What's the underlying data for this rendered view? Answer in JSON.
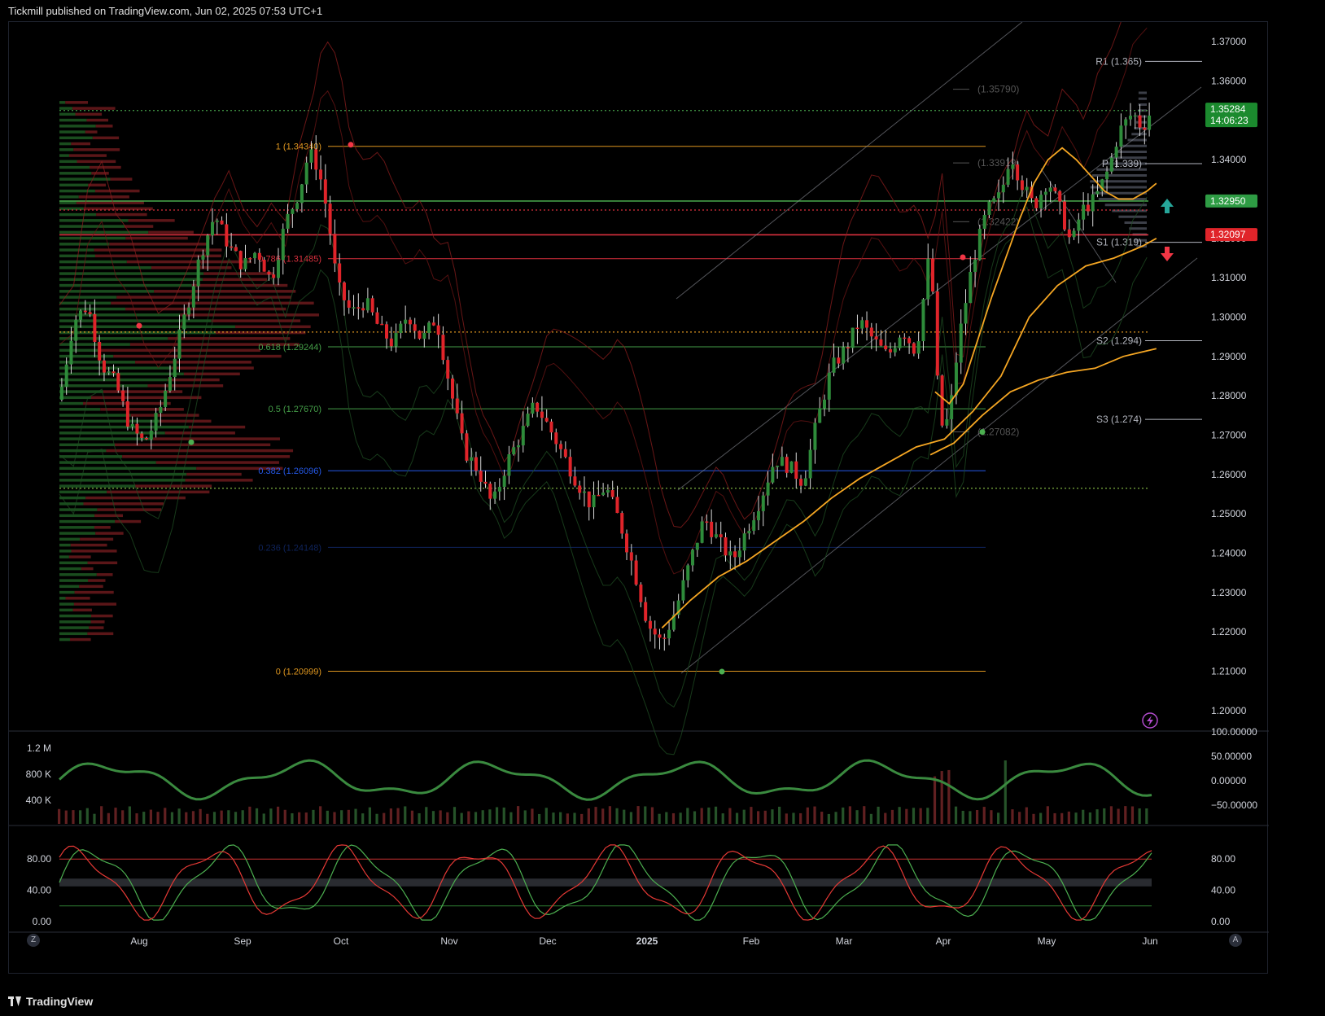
{
  "header": {
    "text": "Tickmill published on TradingView.com, Jun 02, 2025 07:53 UTC+1"
  },
  "footer": {
    "brand": "TradingView"
  },
  "buttons": {
    "left": "Z",
    "right": "A"
  },
  "colors": {
    "up": "#2e8b3a",
    "down": "#e0242a",
    "orange": "#f5a623",
    "green_line": "#4caf50",
    "red_line": "#f23645",
    "blue": "#2962ff"
  },
  "chart_data": {
    "type": "candlestick",
    "ylim": [
      1.195,
      1.375
    ],
    "price_ticks": [
      "1.37000",
      "1.36000",
      "1.35000",
      "1.34000",
      "1.33000",
      "1.32000",
      "1.31000",
      "1.30000",
      "1.29000",
      "1.28000",
      "1.27000",
      "1.26000",
      "1.25000",
      "1.24000",
      "1.23000",
      "1.22000",
      "1.21000",
      "1.20000"
    ],
    "x_ticks": [
      "Aug",
      "Sep",
      "Oct",
      "Nov",
      "Dec",
      "2025",
      "Feb",
      "Mar",
      "Apr",
      "May",
      "Jun"
    ],
    "close_path": [
      [
        0,
        1.279
      ],
      [
        6,
        1.299
      ],
      [
        12,
        1.303
      ],
      [
        18,
        1.288
      ],
      [
        24,
        1.283
      ],
      [
        30,
        1.272
      ],
      [
        36,
        1.268
      ],
      [
        42,
        1.275
      ],
      [
        48,
        1.288
      ],
      [
        54,
        1.302
      ],
      [
        60,
        1.316
      ],
      [
        66,
        1.326
      ],
      [
        72,
        1.318
      ],
      [
        78,
        1.313
      ],
      [
        84,
        1.317
      ],
      [
        90,
        1.309
      ],
      [
        96,
        1.324
      ],
      [
        102,
        1.332
      ],
      [
        106,
        1.342
      ],
      [
        110,
        1.338
      ],
      [
        114,
        1.326
      ],
      [
        118,
        1.308
      ],
      [
        124,
        1.301
      ],
      [
        130,
        1.304
      ],
      [
        136,
        1.297
      ],
      [
        142,
        1.293
      ],
      [
        148,
        1.301
      ],
      [
        154,
        1.294
      ],
      [
        160,
        1.3
      ],
      [
        166,
        1.282
      ],
      [
        172,
        1.266
      ],
      [
        178,
        1.261
      ],
      [
        184,
        1.252
      ],
      [
        190,
        1.263
      ],
      [
        196,
        1.27
      ],
      [
        202,
        1.278
      ],
      [
        208,
        1.272
      ],
      [
        214,
        1.265
      ],
      [
        220,
        1.258
      ],
      [
        226,
        1.252
      ],
      [
        232,
        1.257
      ],
      [
        238,
        1.248
      ],
      [
        244,
        1.236
      ],
      [
        250,
        1.222
      ],
      [
        256,
        1.217
      ],
      [
        262,
        1.226
      ],
      [
        268,
        1.238
      ],
      [
        274,
        1.249
      ],
      [
        280,
        1.243
      ],
      [
        286,
        1.238
      ],
      [
        292,
        1.246
      ],
      [
        298,
        1.254
      ],
      [
        304,
        1.264
      ],
      [
        310,
        1.262
      ],
      [
        316,
        1.258
      ],
      [
        322,
        1.274
      ],
      [
        328,
        1.287
      ],
      [
        334,
        1.292
      ],
      [
        340,
        1.299
      ],
      [
        346,
        1.294
      ],
      [
        352,
        1.29
      ],
      [
        358,
        1.297
      ],
      [
        364,
        1.291
      ],
      [
        370,
        1.318
      ],
      [
        374,
        1.272
      ],
      [
        378,
        1.274
      ],
      [
        382,
        1.294
      ],
      [
        388,
        1.314
      ],
      [
        394,
        1.327
      ],
      [
        400,
        1.331
      ],
      [
        404,
        1.342
      ],
      [
        408,
        1.335
      ],
      [
        414,
        1.328
      ],
      [
        420,
        1.335
      ],
      [
        426,
        1.326
      ],
      [
        430,
        1.318
      ],
      [
        434,
        1.327
      ],
      [
        440,
        1.33
      ],
      [
        446,
        1.338
      ],
      [
        450,
        1.347
      ],
      [
        456,
        1.352
      ],
      [
        460,
        1.348
      ],
      [
        464,
        1.3528
      ]
    ],
    "moving_averages": [
      {
        "name": "orange-fast",
        "points": [
          [
            372,
            1.281
          ],
          [
            378,
            1.278
          ],
          [
            384,
            1.283
          ],
          [
            390,
            1.294
          ],
          [
            396,
            1.305
          ],
          [
            402,
            1.315
          ],
          [
            408,
            1.325
          ],
          [
            414,
            1.334
          ],
          [
            420,
            1.34
          ],
          [
            426,
            1.343
          ],
          [
            432,
            1.34
          ],
          [
            438,
            1.336
          ],
          [
            444,
            1.332
          ],
          [
            450,
            1.33
          ],
          [
            456,
            1.33
          ],
          [
            462,
            1.332
          ],
          [
            466,
            1.334
          ]
        ]
      },
      {
        "name": "orange-slow",
        "points": [
          [
            256,
            1.221
          ],
          [
            268,
            1.228
          ],
          [
            280,
            1.234
          ],
          [
            292,
            1.238
          ],
          [
            304,
            1.243
          ],
          [
            316,
            1.248
          ],
          [
            328,
            1.254
          ],
          [
            340,
            1.259
          ],
          [
            352,
            1.263
          ],
          [
            364,
            1.267
          ],
          [
            376,
            1.269
          ],
          [
            388,
            1.276
          ],
          [
            400,
            1.285
          ],
          [
            412,
            1.3
          ],
          [
            424,
            1.308
          ],
          [
            436,
            1.313
          ],
          [
            448,
            1.315
          ],
          [
            460,
            1.318
          ],
          [
            466,
            1.32
          ]
        ]
      },
      {
        "name": "orange-200",
        "points": [
          [
            370,
            1.265
          ],
          [
            380,
            1.268
          ],
          [
            392,
            1.275
          ],
          [
            404,
            1.281
          ],
          [
            416,
            1.284
          ],
          [
            428,
            1.286
          ],
          [
            440,
            1.287
          ],
          [
            452,
            1.29
          ],
          [
            466,
            1.292
          ]
        ]
      }
    ],
    "fib_levels": [
      {
        "label": "1 (1.34340)",
        "value": 1.3434,
        "color": "#f5a623"
      },
      {
        "label": "0.786 (1.31485)",
        "value": 1.31485,
        "color": "#f23645"
      },
      {
        "label": "0.618 (1.29244)",
        "value": 1.29244,
        "color": "#4caf50"
      },
      {
        "label": "0.5 (1.27670)",
        "value": 1.2767,
        "color": "#4caf50"
      },
      {
        "label": "0.382 (1.26096)",
        "value": 1.26096,
        "color": "#2962ff"
      },
      {
        "label": "0.236 (1.24148)",
        "value": 1.24148,
        "color": "#2962ff"
      },
      {
        "label": "0 (1.20999)",
        "value": 1.20999,
        "color": "#f5a623"
      }
    ],
    "pivots": [
      {
        "label": "R1 (1.365)",
        "value": 1.365
      },
      {
        "label": "P (1.339)",
        "value": 1.339
      },
      {
        "label": "S1 (1.319)",
        "value": 1.319
      },
      {
        "label": "S2 (1.294)",
        "value": 1.294
      },
      {
        "label": "S3 (1.274)",
        "value": 1.274
      }
    ],
    "ghost_labels": [
      {
        "label": "(1.35790)",
        "value": 1.3579
      },
      {
        "label": "(1.33919)",
        "value": 1.33919
      },
      {
        "label": "(1.32422)",
        "value": 1.32422
      },
      {
        "label": "(1.27082)",
        "value": 1.27082
      }
    ],
    "horizontal_lines": [
      {
        "value": 1.3295,
        "color": "#4caf50",
        "style": "solid"
      },
      {
        "value": 1.3209,
        "color": "#f23645",
        "style": "solid"
      },
      {
        "value": 1.3272,
        "color": "#f23645",
        "style": "dotted"
      },
      {
        "value": 1.2962,
        "color": "#f5a623",
        "style": "dotted"
      },
      {
        "value": 1.2565,
        "color": "#8bc34a",
        "style": "dotted"
      },
      {
        "value": 1.3525,
        "color": "#4caf50",
        "style": "dotted"
      }
    ],
    "price_labels": [
      {
        "text": "1.35284",
        "sub": "14:06:23",
        "value": 1.35284,
        "color": "#1b8a2e"
      },
      {
        "text": "1.32950",
        "value": 1.3295,
        "color": "#2e9c44"
      },
      {
        "text": "1.32097",
        "value": 1.32097,
        "color": "#e0242a"
      }
    ],
    "volume_axis": [
      "1.2 M",
      "800 K",
      "400 K"
    ],
    "oscillator_axis": [
      "100.00000",
      "50.00000",
      "0.00000",
      "−50.00000"
    ],
    "stoch_axis_left": [
      "80.00",
      "40.00",
      "0.00"
    ],
    "stoch_axis_right": [
      "80.00",
      "40.00",
      "0.00"
    ]
  }
}
